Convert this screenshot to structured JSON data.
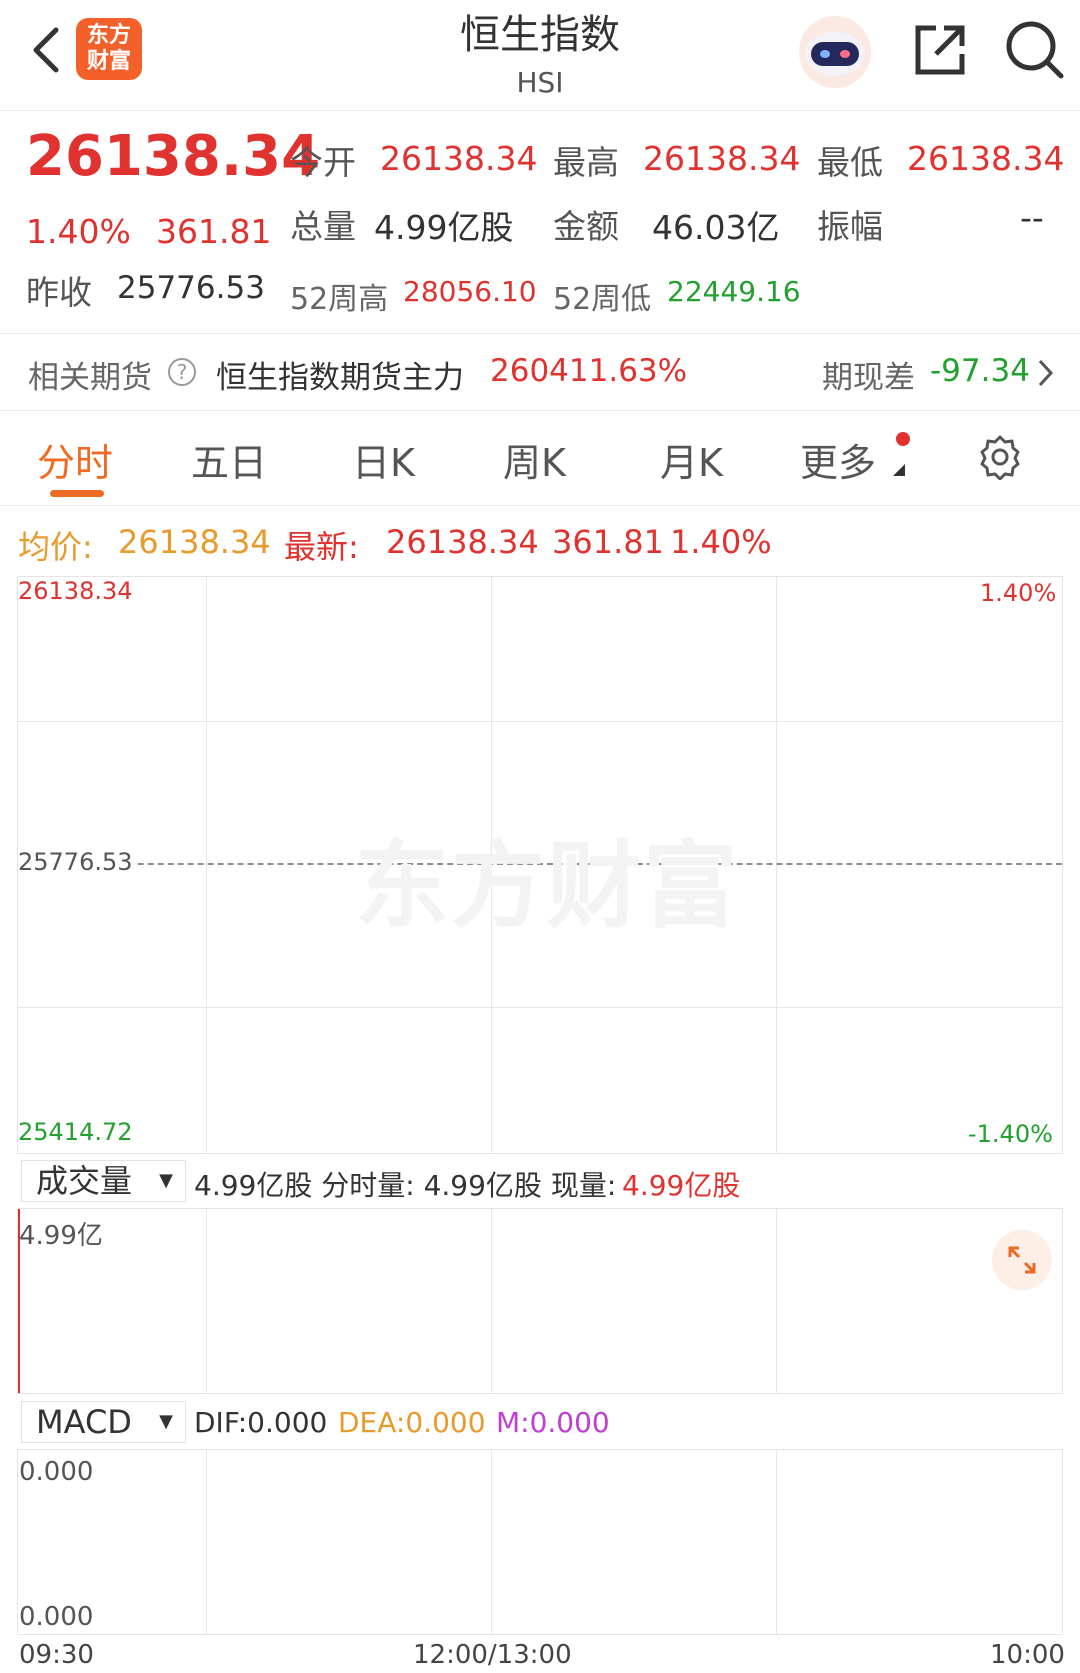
{
  "header": {
    "logo_line1": "东方",
    "logo_line2": "财富",
    "title": "恒生指数",
    "subtitle": "HSI"
  },
  "quote": {
    "price": "26138.34",
    "change_pct": "1.40%",
    "change": "361.81",
    "prev_close_label": "昨收",
    "prev_close": "25776.53",
    "open_label": "今开",
    "open": "26138.34",
    "high_label": "最高",
    "high": "26138.34",
    "low_label": "最低",
    "low": "26138.34",
    "volume_label": "总量",
    "volume": "4.99亿股",
    "amount_label": "金额",
    "amount": "46.03亿",
    "amplitude_label": "振幅",
    "amplitude": "--",
    "w52_high_label": "52周高",
    "w52_high": "28056.10",
    "w52_low_label": "52周低",
    "w52_low": "22449.16"
  },
  "futures": {
    "label": "相关期货",
    "help": "?",
    "name": "恒生指数期货主力",
    "value": "260411.63%",
    "basis_label": "期现差",
    "basis": "-97.34"
  },
  "tabs": [
    {
      "label": "分时"
    },
    {
      "label": "五日"
    },
    {
      "label": "日K"
    },
    {
      "label": "周K"
    },
    {
      "label": "月K"
    },
    {
      "label": "更多"
    }
  ],
  "chart": {
    "avg_label": "均价:",
    "avg": "26138.34",
    "latest_label": "最新:",
    "latest": "26138.34",
    "latest_change": "361.81",
    "latest_pct": "1.40%",
    "y_top": "26138.34",
    "y_mid": "25776.53",
    "y_bottom": "25414.72",
    "pct_top": "1.40%",
    "pct_bottom": "-1.40%",
    "watermark": "东方财富"
  },
  "volume": {
    "selector": "成交量",
    "text": "4.99亿股 分时量: 4.99亿股 现量:",
    "current": "4.99亿股",
    "max_label": "4.99亿"
  },
  "macd": {
    "selector": "MACD",
    "dif": "DIF:0.000",
    "dea": "DEA:0.000",
    "m": "M:0.000",
    "y_top": "0.000",
    "y_bottom": "0.000"
  },
  "time_axis": {
    "start": "09:30",
    "mid": "12:00/13:00",
    "end": "10:00"
  },
  "colors": {
    "up": "#e0322f",
    "down": "#22a12e",
    "accent": "#ef6b24",
    "avg": "#e89a2c",
    "macd_m": "#c03fd1"
  }
}
